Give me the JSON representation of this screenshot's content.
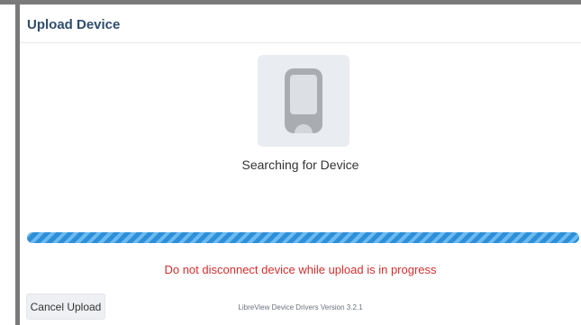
{
  "dialog": {
    "title": "Upload Device",
    "status_text": "Searching for Device",
    "device_icon": "reader-device-icon",
    "progress": {
      "state": "indeterminate",
      "color": "#2e8fd8"
    },
    "warning_text": "Do not disconnect device while upload is in progress",
    "warning_color": "#d32f2f",
    "cancel_label": "Cancel Upload",
    "version_text": "LibreView Device Drivers Version 3.2.1",
    "title_color": "#2f4d6e"
  }
}
